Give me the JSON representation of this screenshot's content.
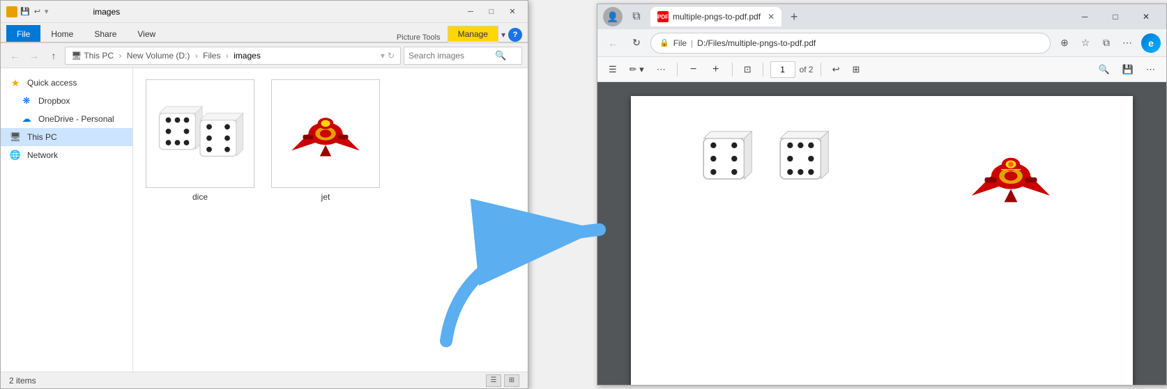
{
  "explorer": {
    "title": "images",
    "tabs": [
      "File",
      "Home",
      "Share",
      "View",
      "Picture Tools",
      "Manage"
    ],
    "breadcrumb": {
      "parts": [
        "This PC",
        "New Volume (D:)",
        "Files",
        "images"
      ]
    },
    "search_placeholder": "Search images",
    "sidebar": {
      "items": [
        {
          "label": "Quick access",
          "icon": "star"
        },
        {
          "label": "Dropbox",
          "icon": "dropbox"
        },
        {
          "label": "OneDrive - Personal",
          "icon": "cloud"
        },
        {
          "label": "This PC",
          "icon": "pc",
          "selected": true
        },
        {
          "label": "Network",
          "icon": "network"
        }
      ]
    },
    "files": [
      {
        "name": "dice",
        "type": "image"
      },
      {
        "name": "jet",
        "type": "image"
      }
    ],
    "status": "2 items",
    "window_controls": [
      "minimize",
      "maximize",
      "close"
    ]
  },
  "browser": {
    "tab": {
      "label": "multiple-pngs-to-pdf.pdf",
      "icon": "pdf"
    },
    "address": {
      "protocol": "File",
      "url": "D:/Files/multiple-pngs-to-pdf.pdf"
    },
    "pdf": {
      "current_page": "1",
      "total_pages": "of 2",
      "toolbar_items": [
        "list-view",
        "draw",
        "more"
      ]
    },
    "window_controls": [
      "minimize",
      "maximize",
      "close"
    ]
  },
  "arrow": {
    "color": "#5baef0",
    "description": "blue curved arrow pointing right"
  },
  "icons": {
    "back": "←",
    "forward": "→",
    "up": "↑",
    "refresh": "↻",
    "search": "🔍",
    "minimize": "─",
    "maximize": "□",
    "close": "✕",
    "plus": "+",
    "minus": "−",
    "chevron_down": "▾",
    "star": "★",
    "list": "☰",
    "grid": "⊞",
    "zoom_in": "+",
    "zoom_out": "−"
  }
}
